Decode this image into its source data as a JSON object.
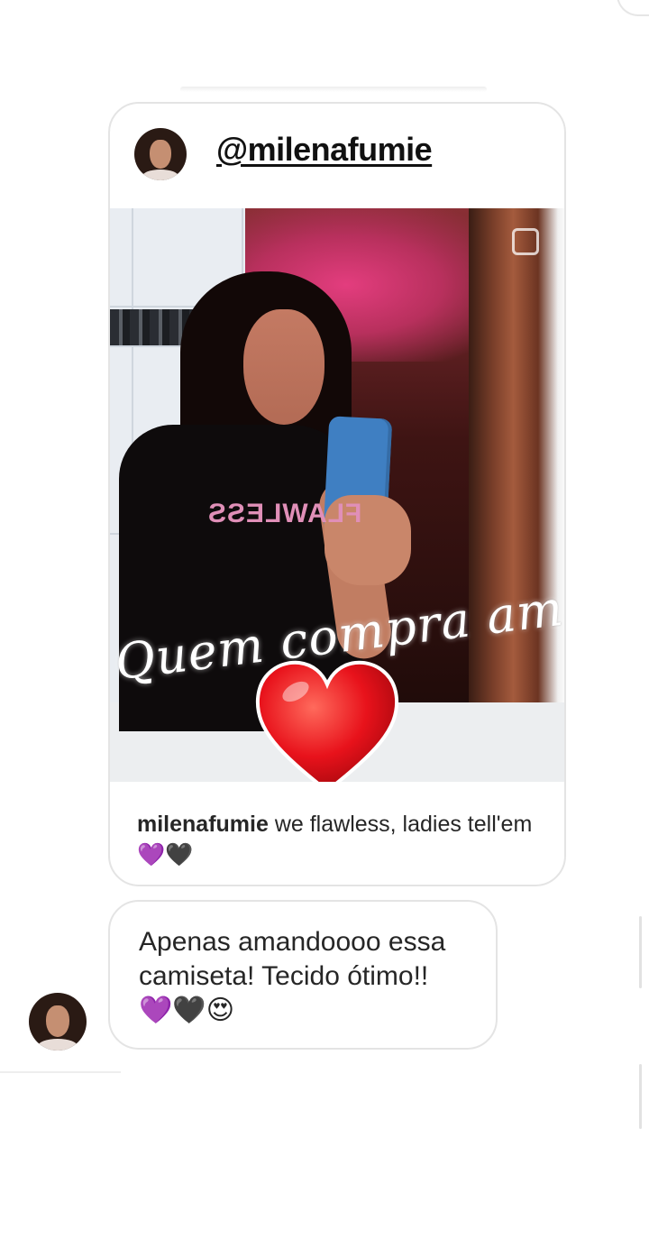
{
  "post": {
    "author_handle": "@milenafumie",
    "caption_user": "milenafumie",
    "caption_text": "we flawless, ladies tell'em 💜🖤",
    "photo": {
      "shirt_text": "FLAWLESS",
      "sticker_text": "Quem compra ama",
      "heart_icon": "heart-icon",
      "heart_color": "#e8121b"
    }
  },
  "message": {
    "text": "Apenas amandoooo essa camiseta! Tecido ótimo!!",
    "emojis": "💜🖤😍"
  }
}
